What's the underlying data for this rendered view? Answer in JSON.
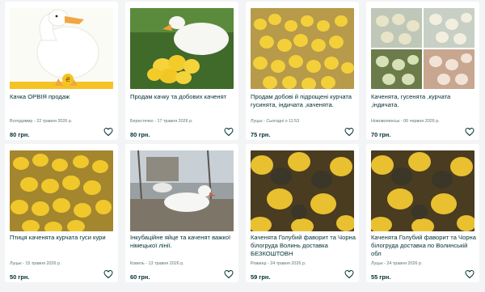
{
  "listings": [
    {
      "title": "Качка ОРВІЯ продаж",
      "meta": "Володимир - 22 травня 2026 р.",
      "price": "80 грн.",
      "image": "white-duck-on-yellow"
    },
    {
      "title": "Продам качку та добових каченят",
      "meta": "Берестечко - 17 травня 2026 р.",
      "price": "80 грн.",
      "image": "duck-with-ducklings"
    },
    {
      "title": "Продам добові й підрощені курчата гусинята, індичата ,каченята.",
      "meta": "Луцьк - Сьогодні о 11:53",
      "price": "75 грн.",
      "image": "crowd-of-yellow-chicks"
    },
    {
      "title": "Каченята, гусенята ,курчата ,індичата.",
      "meta": "Нововолинськ - 06 червня 2026 р.",
      "price": "70 грн.",
      "image": "collage-of-poultry"
    },
    {
      "title": "Птиця каченята курчата гуси кури",
      "meta": "Луцьк - 15 травня 2026 р.",
      "price": "50 грн.",
      "image": "ducklings-in-crate"
    },
    {
      "title": "Інкубаційне яйце та каченят важкої німецької лінії.",
      "meta": "Ковель - 13 травня 2026 р.",
      "price": "60 грн.",
      "image": "white-ducks-in-yard"
    },
    {
      "title": "Каченята Голубий фаворит та Чорна білогруда Волинь доставка БЕЗКОШТОВН",
      "meta": "Рованці - 24 травня 2026 р.",
      "price": "59 грн.",
      "image": "dark-ducklings-closeup"
    },
    {
      "title": "Каченята Голубий фаворит та Чорна білогруда доставка по Волинській обл",
      "meta": "Луцьк - 24 травня 2026 р.",
      "price": "55 грн.",
      "image": "dark-ducklings-closeup"
    }
  ],
  "icons": {
    "favorite": "heart-outline-icon"
  },
  "colors": {
    "text": "#002f34",
    "meta": "#5e7478",
    "background": "#f2f4f5",
    "card": "#ffffff"
  }
}
